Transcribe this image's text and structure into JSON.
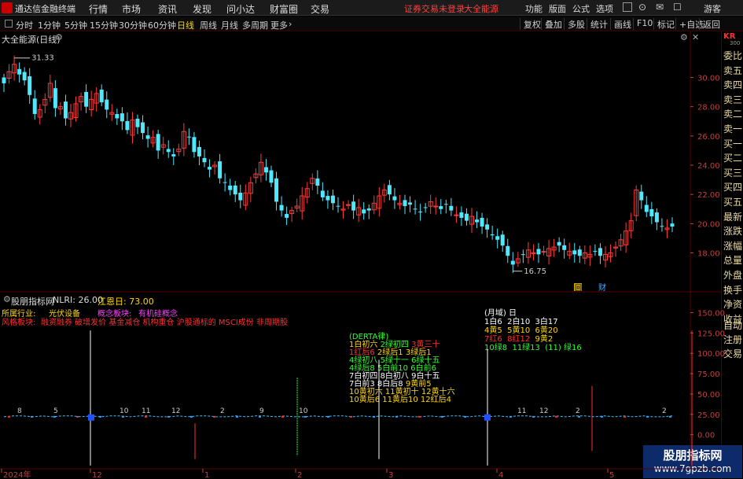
{
  "app": {
    "title": "通达信金融终端"
  },
  "menu": [
    "行情",
    "市场",
    "资讯",
    "发现",
    "问小达",
    "财富圈",
    "交易"
  ],
  "warning": "证券交易未登录",
  "stock_name_top": "大全能源",
  "top_right": [
    "功能",
    "版面",
    "公式",
    "选项",
    "游客"
  ],
  "periods": [
    "分时",
    "1分钟",
    "5分钟",
    "15分钟",
    "30分钟",
    "60分钟",
    "日线",
    "周线",
    "月线",
    "多周期",
    "更多"
  ],
  "active_period": "日线",
  "toolbar": [
    "复权",
    "叠加",
    "多股",
    "统计",
    "画线",
    "F10",
    "标记",
    "+自选",
    "返回"
  ],
  "right_side": {
    "code": "KR",
    "code_sub": "300",
    "items": [
      "委比",
      "卖五",
      "卖四",
      "卖三",
      "卖二",
      "卖一",
      "买一",
      "买二",
      "买三",
      "买四",
      "买五",
      "最新",
      "涨跌",
      "涨幅",
      "总量",
      "外盘",
      "换手",
      "净资",
      "收益"
    ],
    "lower": [
      "自动",
      "注册",
      "交易"
    ]
  },
  "main_chart": {
    "title": "大全能源(日线)",
    "high_label": "31.33",
    "low_label": "16.75",
    "markers": [
      "回",
      "财"
    ]
  },
  "indicator": {
    "name": "股朋指标网",
    "nlri": "NLRI: 26.00",
    "jiangen": "江恩日: 73.00"
  },
  "industry": {
    "label": "所属行业:",
    "value": "光伏设备",
    "concept_label": "概念板块:",
    "concept_value": "有机硅概念",
    "style_label": "风格板块:",
    "style_value": "融资融券 破增发价 基金减仓 机构重仓 沪股通标的 MSCI成份 非周期股"
  },
  "annotations": {
    "derta": "(DERTA律)",
    "month_tag": "(月域)",
    "month_day": "日",
    "g1": [
      "1白初六",
      "2绿初四",
      "3黄三十",
      "1红后6",
      "2绿后1",
      "3绿后1"
    ],
    "g2": [
      "4绿初八",
      "5绿十一",
      "6绿十五",
      "4绿后8",
      "5白前10",
      "6白前6"
    ],
    "g3": [
      "7白初四",
      "8白初八",
      "9白十五",
      "7白前3",
      "8白后8",
      "9黄前5"
    ],
    "g4": [
      "10黄初六",
      "11黄初十",
      "12黄十六",
      "10黄后6",
      "11黄后10",
      "12红后4"
    ],
    "m1": [
      "1白6",
      "2白10",
      "3白17"
    ],
    "m2": [
      "4黄5",
      "5黄10",
      "6黄20"
    ],
    "m3": [
      "7红6",
      "8红12",
      "9黄2"
    ],
    "m4": [
      "10绿8",
      "11绿13",
      "(11)",
      "绿16"
    ]
  },
  "x_axis": [
    "2024年",
    "12",
    "1",
    "2",
    "3",
    "4",
    "5"
  ],
  "watermark": {
    "name": "股朋指标网",
    "url": "www.7gpzb.com"
  },
  "colors": {
    "up": "#ff3a3a",
    "down": "#4ee8ff",
    "bg": "#000000",
    "axis": "#5a0000",
    "highlight": "#ffd800"
  },
  "chart_data": [
    {
      "type": "candlestick",
      "title": "大全能源(日线)",
      "y_ticks": [
        18,
        20,
        22,
        24,
        26,
        28,
        30
      ],
      "ylim": [
        15.5,
        32.5
      ],
      "high": 31.33,
      "low": 16.75,
      "close_path": [
        29.6,
        30.4,
        30.9,
        30.2,
        29.8,
        28.8,
        27.5,
        27.8,
        28.5,
        29.6,
        27.9,
        28.0,
        27.2,
        27.6,
        28.2,
        28.7,
        28.0,
        28.5,
        28.9,
        28.3,
        27.8,
        27.6,
        27.2,
        27.0,
        26.4,
        27.1,
        26.6,
        26.2,
        25.8,
        25.9,
        25.0,
        25.4,
        24.9,
        24.6,
        25.1,
        26.3,
        25.9,
        24.9,
        24.6,
        24.2,
        23.7,
        24.0,
        23.1,
        22.8,
        22.3,
        22.0,
        21.6,
        22.1,
        22.8,
        23.4,
        24.2,
        23.5,
        22.8,
        21.5,
        20.9,
        20.4,
        20.9,
        21.2,
        21.9,
        22.4,
        23.1,
        22.6,
        21.8,
        21.6,
        21.4,
        21.2,
        21.0,
        21.3,
        20.9,
        21.1,
        20.7,
        20.9,
        21.4,
        21.9,
        22.3,
        22.0,
        21.6,
        21.4,
        21.2,
        21.3,
        21.0,
        20.8,
        21.1,
        21.5,
        21.2,
        21.0,
        21.3,
        20.9,
        20.6,
        20.4,
        20.2,
        20.5,
        20.1,
        19.8,
        19.6,
        19.2,
        18.9,
        18.5,
        17.8,
        17.2,
        17.6,
        17.9,
        18.2,
        18.0,
        17.9,
        18.1,
        18.3,
        18.4,
        18.5,
        18.2,
        18.1,
        17.9,
        17.8,
        18.0,
        17.9,
        18.1,
        17.8,
        17.9,
        18.0,
        18.4,
        18.9,
        19.5,
        20.2,
        22.3,
        21.6,
        20.8,
        20.5,
        20.1,
        19.8,
        19.7,
        19.8
      ]
    },
    {
      "type": "line",
      "title": "股朋指标网",
      "y_ticks": [
        0,
        25,
        50,
        75,
        100,
        125,
        150
      ],
      "ylim": [
        -40,
        165
      ],
      "series": [
        {
          "values": [
            2,
            3,
            3,
            2,
            3,
            2,
            3,
            3,
            2,
            3,
            2,
            3,
            3,
            2,
            3,
            3,
            2,
            2,
            3,
            2,
            3,
            3,
            2,
            2,
            3,
            2,
            3,
            3,
            2,
            3,
            2,
            2,
            3,
            2,
            3,
            3,
            2,
            3,
            2,
            3,
            2,
            3,
            2,
            2,
            3,
            2,
            3,
            3,
            2,
            3,
            2,
            3,
            2,
            3,
            3,
            2,
            2,
            3,
            2,
            3,
            3,
            2,
            3,
            2,
            3,
            2,
            3,
            2,
            2,
            3
          ]
        }
      ],
      "spike_labels": [
        "8",
        "5",
        "10",
        "11",
        "12",
        "2",
        "9",
        "10",
        "11",
        "12",
        "2",
        "2"
      ],
      "spikes": [
        {
          "x": 115,
          "top": 128,
          "bottom": -38,
          "color": "#ffffff"
        },
        {
          "x": 248,
          "top": 14,
          "bottom": -30,
          "color": "#ff3030"
        },
        {
          "x": 378,
          "top": 70,
          "bottom": -26,
          "color": "#30ff30"
        },
        {
          "x": 482,
          "top": 92,
          "bottom": -30,
          "color": "#ffffff"
        },
        {
          "x": 620,
          "top": 105,
          "bottom": -38,
          "color": "#ffffff"
        },
        {
          "x": 753,
          "top": 60,
          "bottom": -20,
          "color": "#ff3030"
        },
        {
          "x": 880,
          "top": 128,
          "bottom": -38,
          "color": "#ff3030"
        }
      ]
    }
  ]
}
